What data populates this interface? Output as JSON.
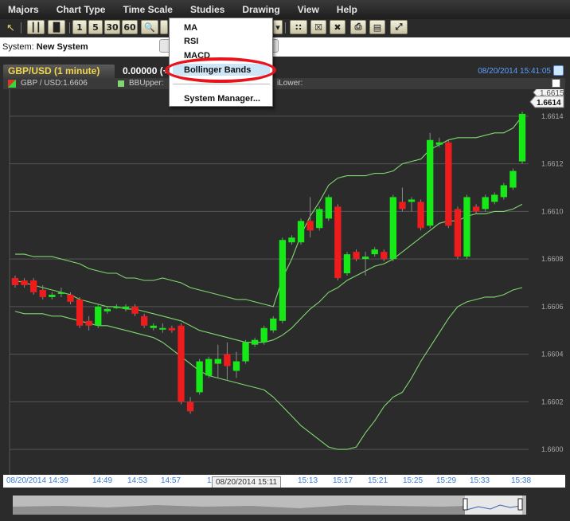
{
  "menu": [
    "Majors",
    "Chart Type",
    "Time Scale",
    "Studies",
    "Drawing",
    "View",
    "Help"
  ],
  "toolbar": {
    "buttons": [
      "1",
      "5",
      "30",
      "60"
    ]
  },
  "system": {
    "label": "System:",
    "name": "New System"
  },
  "chart_header": {
    "title": "GBP/USD (1 minute)",
    "value": "0.00000 (+",
    "datetime": "08/20/2014 15:41:05"
  },
  "legend": {
    "symbol": "GBP / USD:1.6606",
    "upper": "BBUpper:",
    "lower": "iLower:"
  },
  "studies_menu": {
    "items": [
      "MA",
      "RSI",
      "MACD",
      "Bollinger Bands"
    ],
    "manager": "System Manager...",
    "highlighted": "Bollinger Bands"
  },
  "price_axis": {
    "current_price": "1.6614",
    "top_price": "1.6615",
    "ticks": [
      "1.6614",
      "1.6612",
      "1.6610",
      "1.6608",
      "1.6606",
      "1.6604",
      "1.6602",
      "1.6600"
    ]
  },
  "time_axis": {
    "first": "08/20/2014 14:39",
    "ticks": [
      "14:49",
      "14:53",
      "14:57",
      "15:",
      "15:13",
      "15:17",
      "15:21",
      "15:25",
      "15:29",
      "15:33",
      "15:38"
    ],
    "highlight": "08/20/2014 15:11"
  },
  "colors": {
    "up": "#17e817",
    "down": "#ee1c1c",
    "band": "#7fd86f",
    "background": "#2b2b2b",
    "grid": "#555555"
  },
  "chart_data": {
    "type": "candlestick",
    "title": "GBP/USD (1 minute)",
    "ylim": [
      1.6599,
      1.6615
    ],
    "candles": [
      {
        "o": 1.66072,
        "c": 1.66069,
        "h": 1.66073,
        "l": 1.66068
      },
      {
        "o": 1.66071,
        "c": 1.66069,
        "h": 1.66072,
        "l": 1.66068
      },
      {
        "o": 1.66071,
        "c": 1.66066,
        "h": 1.66072,
        "l": 1.66065
      },
      {
        "o": 1.66067,
        "c": 1.66064,
        "h": 1.66069,
        "l": 1.66063
      },
      {
        "o": 1.66064,
        "c": 1.66065,
        "h": 1.66066,
        "l": 1.66063
      },
      {
        "o": 1.66066,
        "c": 1.66066,
        "h": 1.66068,
        "l": 1.66064
      },
      {
        "o": 1.66065,
        "c": 1.66062,
        "h": 1.66066,
        "l": 1.66061
      },
      {
        "o": 1.66063,
        "c": 1.66052,
        "h": 1.66064,
        "l": 1.66051
      },
      {
        "o": 1.66054,
        "c": 1.66052,
        "h": 1.66056,
        "l": 1.6605
      },
      {
        "o": 1.66052,
        "c": 1.6606,
        "h": 1.66061,
        "l": 1.66051
      },
      {
        "o": 1.66058,
        "c": 1.66059,
        "h": 1.6606,
        "l": 1.66057
      },
      {
        "o": 1.6606,
        "c": 1.6606,
        "h": 1.66061,
        "l": 1.66059
      },
      {
        "o": 1.66059,
        "c": 1.6606,
        "h": 1.66061,
        "l": 1.66058
      },
      {
        "o": 1.6606,
        "c": 1.66057,
        "h": 1.66061,
        "l": 1.66056
      },
      {
        "o": 1.66056,
        "c": 1.66052,
        "h": 1.66057,
        "l": 1.66051
      },
      {
        "o": 1.66051,
        "c": 1.66052,
        "h": 1.66053,
        "l": 1.6605
      },
      {
        "o": 1.66051,
        "c": 1.66051,
        "h": 1.66053,
        "l": 1.66049
      },
      {
        "o": 1.66051,
        "c": 1.6605,
        "h": 1.66052,
        "l": 1.66049
      },
      {
        "o": 1.66052,
        "c": 1.6602,
        "h": 1.66053,
        "l": 1.66019
      },
      {
        "o": 1.6602,
        "c": 1.66016,
        "h": 1.66022,
        "l": 1.66015
      },
      {
        "o": 1.66024,
        "c": 1.66037,
        "h": 1.66038,
        "l": 1.66023
      },
      {
        "o": 1.66031,
        "c": 1.66038,
        "h": 1.66039,
        "l": 1.6603
      },
      {
        "o": 1.66036,
        "c": 1.66038,
        "h": 1.66044,
        "l": 1.6603
      },
      {
        "o": 1.6604,
        "c": 1.66035,
        "h": 1.66045,
        "l": 1.66029
      },
      {
        "o": 1.66033,
        "c": 1.66037,
        "h": 1.66041,
        "l": 1.6603
      },
      {
        "o": 1.66037,
        "c": 1.66045,
        "h": 1.66046,
        "l": 1.66036
      },
      {
        "o": 1.66044,
        "c": 1.66046,
        "h": 1.66047,
        "l": 1.66043
      },
      {
        "o": 1.66045,
        "c": 1.66051,
        "h": 1.66052,
        "l": 1.66044
      },
      {
        "o": 1.6605,
        "c": 1.66055,
        "h": 1.66056,
        "l": 1.66049
      },
      {
        "o": 1.66054,
        "c": 1.66088,
        "h": 1.66089,
        "l": 1.66053
      },
      {
        "o": 1.66087,
        "c": 1.66089,
        "h": 1.6609,
        "l": 1.66086
      },
      {
        "o": 1.66087,
        "c": 1.66096,
        "h": 1.66097,
        "l": 1.66086
      },
      {
        "o": 1.66096,
        "c": 1.66092,
        "h": 1.66106,
        "l": 1.66089
      },
      {
        "o": 1.66093,
        "c": 1.66101,
        "h": 1.66102,
        "l": 1.66092
      },
      {
        "o": 1.66097,
        "c": 1.66106,
        "h": 1.66107,
        "l": 1.66096
      },
      {
        "o": 1.66102,
        "c": 1.66072,
        "h": 1.66103,
        "l": 1.66071
      },
      {
        "o": 1.66074,
        "c": 1.66082,
        "h": 1.66083,
        "l": 1.66073
      },
      {
        "o": 1.66083,
        "c": 1.6608,
        "h": 1.66084,
        "l": 1.66079
      },
      {
        "o": 1.6608,
        "c": 1.66081,
        "h": 1.66083,
        "l": 1.66073
      },
      {
        "o": 1.66082,
        "c": 1.66084,
        "h": 1.66085,
        "l": 1.66081
      },
      {
        "o": 1.66083,
        "c": 1.6608,
        "h": 1.66084,
        "l": 1.66079
      },
      {
        "o": 1.6608,
        "c": 1.66106,
        "h": 1.66107,
        "l": 1.66079
      },
      {
        "o": 1.66104,
        "c": 1.66101,
        "h": 1.6611,
        "l": 1.661
      },
      {
        "o": 1.66104,
        "c": 1.66105,
        "h": 1.66106,
        "l": 1.661
      },
      {
        "o": 1.66104,
        "c": 1.66093,
        "h": 1.66105,
        "l": 1.66092
      },
      {
        "o": 1.66094,
        "c": 1.6613,
        "h": 1.66133,
        "l": 1.66093
      },
      {
        "o": 1.66128,
        "c": 1.66129,
        "h": 1.66131,
        "l": 1.66127
      },
      {
        "o": 1.66129,
        "c": 1.66094,
        "h": 1.6613,
        "l": 1.66093
      },
      {
        "o": 1.66101,
        "c": 1.66081,
        "h": 1.66102,
        "l": 1.6608
      },
      {
        "o": 1.66081,
        "c": 1.66106,
        "h": 1.66107,
        "l": 1.6608
      },
      {
        "o": 1.66102,
        "c": 1.661,
        "h": 1.66103,
        "l": 1.66099
      },
      {
        "o": 1.66101,
        "c": 1.66106,
        "h": 1.66107,
        "l": 1.661
      },
      {
        "o": 1.66104,
        "c": 1.66107,
        "h": 1.66108,
        "l": 1.66103
      },
      {
        "o": 1.66106,
        "c": 1.66111,
        "h": 1.66112,
        "l": 1.66105
      },
      {
        "o": 1.6611,
        "c": 1.66117,
        "h": 1.66118,
        "l": 1.66109
      },
      {
        "o": 1.66121,
        "c": 1.66141,
        "h": 1.66142,
        "l": 1.6612
      }
    ],
    "bb_upper": [
      1.66082,
      1.66082,
      1.66081,
      1.66081,
      1.66081,
      1.6608,
      1.66079,
      1.66078,
      1.66076,
      1.66075,
      1.66074,
      1.66074,
      1.66072,
      1.66072,
      1.66071,
      1.66071,
      1.66072,
      1.66071,
      1.6607,
      1.66068,
      1.66067,
      1.66066,
      1.66065,
      1.66064,
      1.66063,
      1.66063,
      1.66062,
      1.66061,
      1.6606,
      1.66072,
      1.6608,
      1.6609,
      1.66098,
      1.66104,
      1.66111,
      1.66114,
      1.66115,
      1.66115,
      1.66115,
      1.66116,
      1.66116,
      1.66117,
      1.6612,
      1.66121,
      1.66122,
      1.66126,
      1.66128,
      1.6613,
      1.66131,
      1.66131,
      1.66131,
      1.66132,
      1.66133,
      1.66133,
      1.66135,
      1.6614
    ],
    "bb_middle": [
      1.66071,
      1.6607,
      1.66069,
      1.66068,
      1.66067,
      1.66066,
      1.66065,
      1.66063,
      1.66062,
      1.66061,
      1.6606,
      1.6606,
      1.66059,
      1.66059,
      1.66058,
      1.66057,
      1.66056,
      1.66055,
      1.66054,
      1.66052,
      1.6605,
      1.66049,
      1.66048,
      1.66047,
      1.66046,
      1.66045,
      1.66045,
      1.66045,
      1.66046,
      1.66048,
      1.66051,
      1.66055,
      1.66059,
      1.66062,
      1.66066,
      1.66068,
      1.66071,
      1.66073,
      1.66075,
      1.66077,
      1.66078,
      1.6608,
      1.66083,
      1.66086,
      1.66089,
      1.66092,
      1.66095,
      1.66096,
      1.66096,
      1.66098,
      1.66099,
      1.66099,
      1.661,
      1.661,
      1.66101,
      1.66103
    ],
    "bb_lower": [
      1.66058,
      1.66057,
      1.66057,
      1.66057,
      1.66056,
      1.66056,
      1.66055,
      1.66054,
      1.66053,
      1.66052,
      1.66052,
      1.66051,
      1.6605,
      1.66049,
      1.66048,
      1.66047,
      1.66045,
      1.66042,
      1.66039,
      1.66036,
      1.66033,
      1.66031,
      1.6603,
      1.66029,
      1.66028,
      1.66027,
      1.66026,
      1.66025,
      1.66022,
      1.66018,
      1.66014,
      1.6601,
      1.66007,
      1.66004,
      1.66001,
      1.66,
      1.66,
      1.66001,
      1.66007,
      1.66012,
      1.66018,
      1.66022,
      1.66024,
      1.6603,
      1.66037,
      1.66043,
      1.66049,
      1.66055,
      1.6606,
      1.66062,
      1.66063,
      1.66064,
      1.66064,
      1.66065,
      1.66067,
      1.66068
    ]
  }
}
